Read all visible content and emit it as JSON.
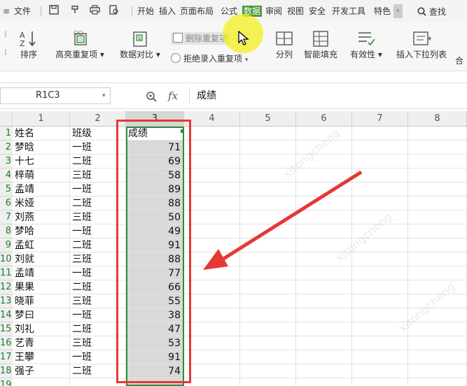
{
  "menu": {
    "file": "文件",
    "tabs": [
      "开始",
      "插入",
      "页面布局",
      "公式",
      "数据",
      "审阅",
      "视图",
      "安全",
      "开发工具",
      "特色"
    ],
    "active_tab": "数据",
    "search": "查找"
  },
  "ribbon": {
    "sort": "排序",
    "highlight_dup": "高亮重复项",
    "data_compare": "数据对比",
    "remove_dup": "删除重复项",
    "reject_dup": "拒绝录入重复项",
    "split": "分列",
    "smart_fill": "智能填充",
    "validity": "有效性",
    "insert_dropdown": "插入下拉列表",
    "merge": "合"
  },
  "formula_bar": {
    "cell_ref": "R1C3",
    "fx": "fx",
    "content": "成绩"
  },
  "sheet": {
    "columns": [
      "1",
      "2",
      "3",
      "4",
      "5",
      "6",
      "7",
      "8"
    ],
    "rows": [
      {
        "n": "1",
        "name": "姓名",
        "class": "班级",
        "score": "成绩"
      },
      {
        "n": "2",
        "name": "梦晗",
        "class": "一班",
        "score": "71"
      },
      {
        "n": "3",
        "name": "十七",
        "class": "二班",
        "score": "69"
      },
      {
        "n": "4",
        "name": "梓萌",
        "class": "三班",
        "score": "58"
      },
      {
        "n": "5",
        "name": "孟靖",
        "class": "一班",
        "score": "89"
      },
      {
        "n": "6",
        "name": "米娅",
        "class": "二班",
        "score": "88"
      },
      {
        "n": "7",
        "name": "刘燕",
        "class": "三班",
        "score": "50"
      },
      {
        "n": "8",
        "name": "梦哈",
        "class": "一班",
        "score": "49"
      },
      {
        "n": "9",
        "name": "孟虹",
        "class": "二班",
        "score": "91"
      },
      {
        "n": "10",
        "name": "刘就",
        "class": "三班",
        "score": "88"
      },
      {
        "n": "11",
        "name": "孟靖",
        "class": "一班",
        "score": "77"
      },
      {
        "n": "12",
        "name": "果果",
        "class": "二班",
        "score": "66"
      },
      {
        "n": "13",
        "name": "晓菲",
        "class": "三班",
        "score": "55"
      },
      {
        "n": "14",
        "name": "梦曰",
        "class": "一班",
        "score": "38"
      },
      {
        "n": "15",
        "name": "刘礼",
        "class": "二班",
        "score": "47"
      },
      {
        "n": "16",
        "name": "艺青",
        "class": "三班",
        "score": "53"
      },
      {
        "n": "17",
        "name": "王攀",
        "class": "一班",
        "score": "91"
      },
      {
        "n": "18",
        "name": "强子",
        "class": "二班",
        "score": "74"
      },
      {
        "n": "19",
        "name": "",
        "class": "",
        "score": ""
      }
    ]
  },
  "colors": {
    "active_tab": "#4a9a3c",
    "selection_border": "#2e8b3e",
    "annotation_red": "#e53935",
    "cursor_highlight": "#f5f028"
  }
}
